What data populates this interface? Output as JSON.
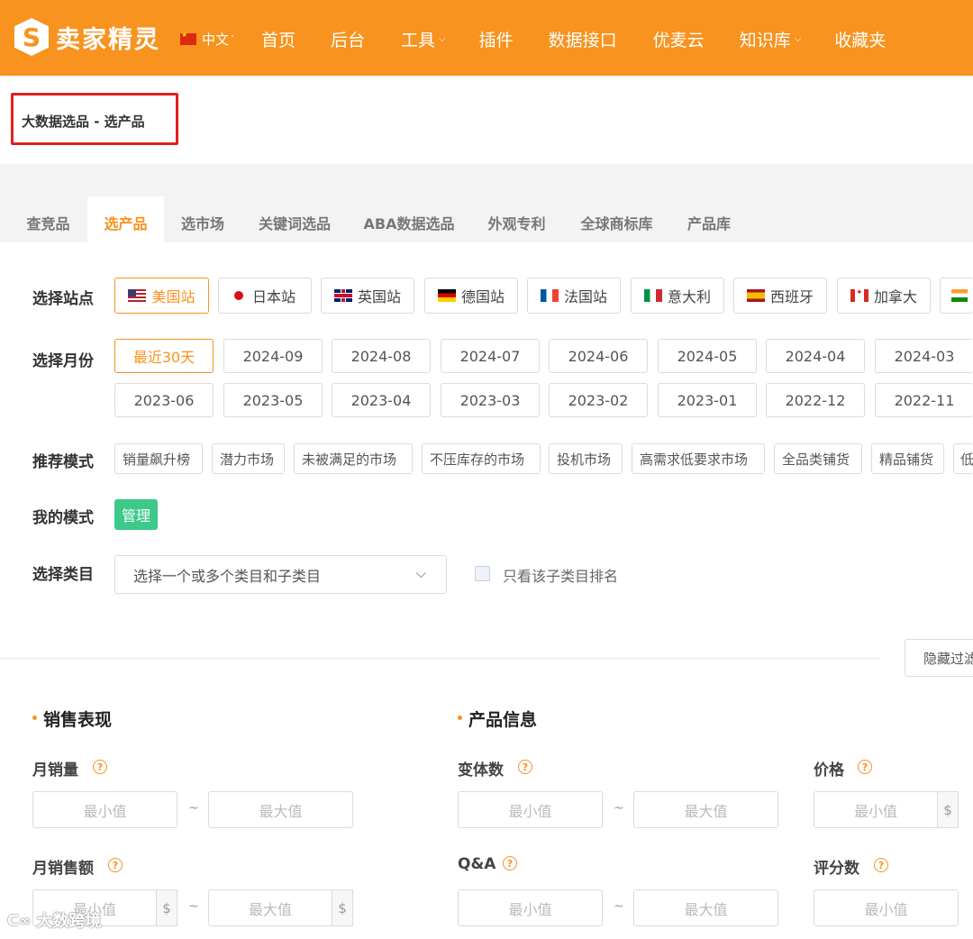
{
  "header": {
    "logo_text": "卖家精灵",
    "logo_glyph": "S",
    "lang": "中文",
    "nav": [
      {
        "label": "首页",
        "has_dropdown": false
      },
      {
        "label": "后台",
        "has_dropdown": false
      },
      {
        "label": "工具",
        "has_dropdown": true
      },
      {
        "label": "插件",
        "has_dropdown": false
      },
      {
        "label": "数据接口",
        "has_dropdown": false
      },
      {
        "label": "优麦云",
        "has_dropdown": false
      },
      {
        "label": "知识库",
        "has_dropdown": true
      },
      {
        "label": "收藏夹",
        "has_dropdown": false
      }
    ],
    "accent": "#f7931e"
  },
  "breadcrumb": "大数据选品 - 选产品",
  "tabs": [
    "查竞品",
    "选产品",
    "选市场",
    "关键词选品",
    "ABA数据选品",
    "外观专利",
    "全球商标库",
    "产品库"
  ],
  "active_tab": "选产品",
  "filters": {
    "site_label": "选择站点",
    "sites": [
      "美国站",
      "日本站",
      "英国站",
      "德国站",
      "法国站",
      "意大利",
      "西班牙",
      "加拿大",
      ""
    ],
    "active_site": "美国站",
    "month_label": "选择月份",
    "months_row1": [
      "最近30天",
      "2024-09",
      "2024-08",
      "2024-07",
      "2024-06",
      "2024-05",
      "2024-04",
      "2024-03"
    ],
    "months_row2": [
      "2023-06",
      "2023-05",
      "2023-04",
      "2023-03",
      "2023-02",
      "2023-01",
      "2022-12",
      "2022-11"
    ],
    "active_month": "最近30天",
    "mode_label": "推荐模式",
    "modes": [
      "销量飙升榜",
      "潜力市场",
      "未被满足的市场",
      "不压库存的市场",
      "投机市场",
      "高需求低要求市场",
      "全品类铺货",
      "精品铺货",
      "低"
    ],
    "my_mode_label": "我的模式",
    "manage_button": "管理",
    "category_label": "选择类目",
    "category_placeholder": "选择一个或多个类目和子类目",
    "subcategory_only": "只看该子类目排名",
    "hide_filter_button": "隐藏过滤"
  },
  "sections": {
    "sales": {
      "title": "销售表现",
      "fields": [
        {
          "label": "月销量",
          "min": "最小值",
          "max": "最大值"
        },
        {
          "label": "月销售额",
          "min": "最小值",
          "max": "最大值",
          "unit": "$"
        }
      ]
    },
    "product": {
      "title": "产品信息",
      "fields": [
        {
          "label": "变体数",
          "min": "最小值",
          "max": "最大值"
        },
        {
          "label": "Q&A",
          "min": "最小值",
          "max": "最大值"
        }
      ]
    },
    "price": {
      "label": "价格",
      "min": "最小值",
      "unit": "$"
    },
    "rating_count": {
      "label": "评分数",
      "min": "最小值"
    }
  },
  "help_glyph": "?",
  "tilde": "~",
  "watermark": "大数跨境"
}
